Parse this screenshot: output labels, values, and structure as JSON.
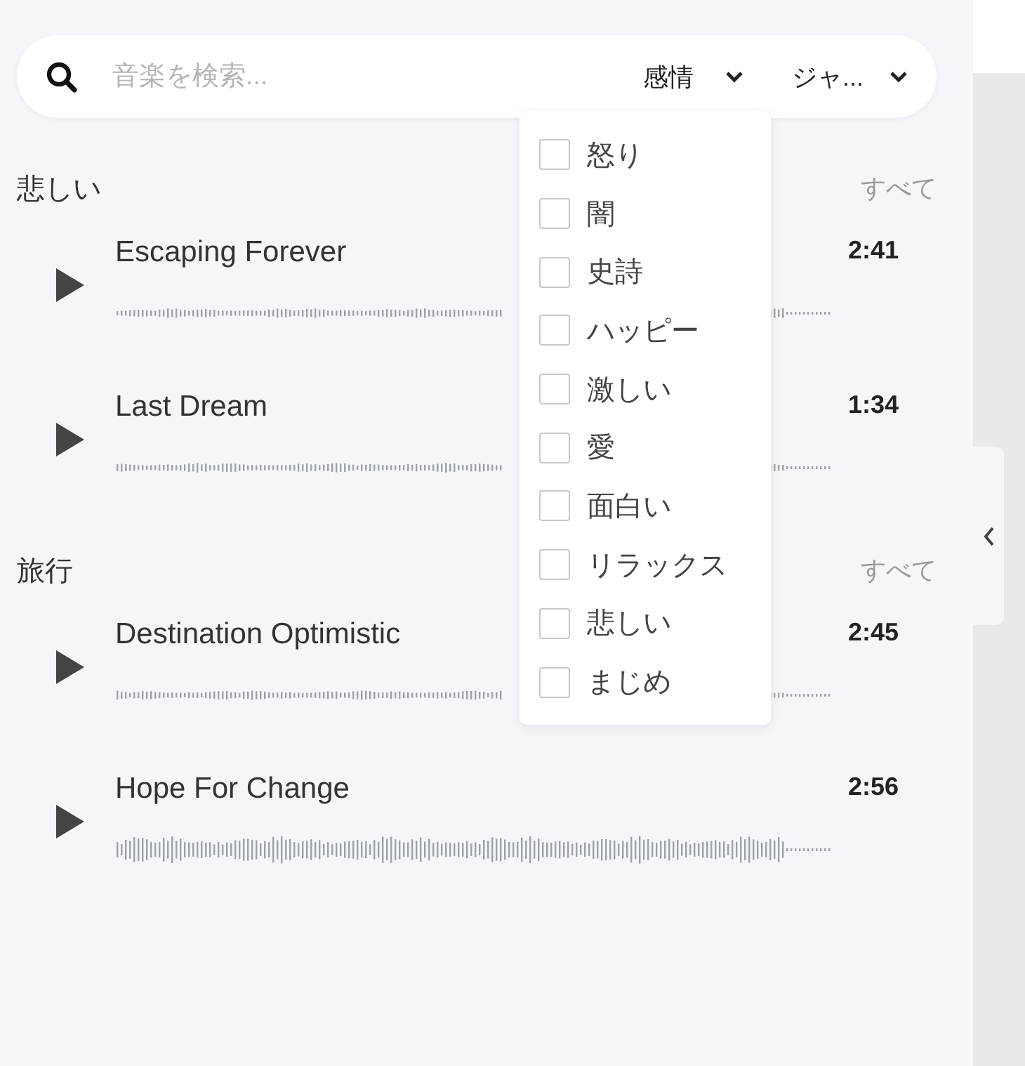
{
  "search": {
    "placeholder": "音楽を検索..."
  },
  "filters": [
    {
      "label": "感情",
      "expanded": true,
      "options": [
        {
          "label": "怒り",
          "checked": false
        },
        {
          "label": "闇",
          "checked": false
        },
        {
          "label": "史詩",
          "checked": false
        },
        {
          "label": "ハッピー",
          "checked": false
        },
        {
          "label": "激しい",
          "checked": false
        },
        {
          "label": "愛",
          "checked": false
        },
        {
          "label": "面白い",
          "checked": false
        },
        {
          "label": "リラックス",
          "checked": false
        },
        {
          "label": "悲しい",
          "checked": false
        },
        {
          "label": "まじめ",
          "checked": false
        }
      ]
    },
    {
      "label": "ジャ...",
      "expanded": false
    }
  ],
  "sections": [
    {
      "title": "悲しい",
      "link": "すべて",
      "tracks": [
        {
          "title": "Escaping Forever",
          "duration": "2:41"
        },
        {
          "title": "Last Dream",
          "duration": "1:34"
        }
      ]
    },
    {
      "title": "旅行",
      "link": "すべて",
      "tracks": [
        {
          "title": "Destination Optimistic",
          "duration": "2:45"
        },
        {
          "title": "Hope For Change",
          "duration": "2:56"
        }
      ]
    }
  ]
}
